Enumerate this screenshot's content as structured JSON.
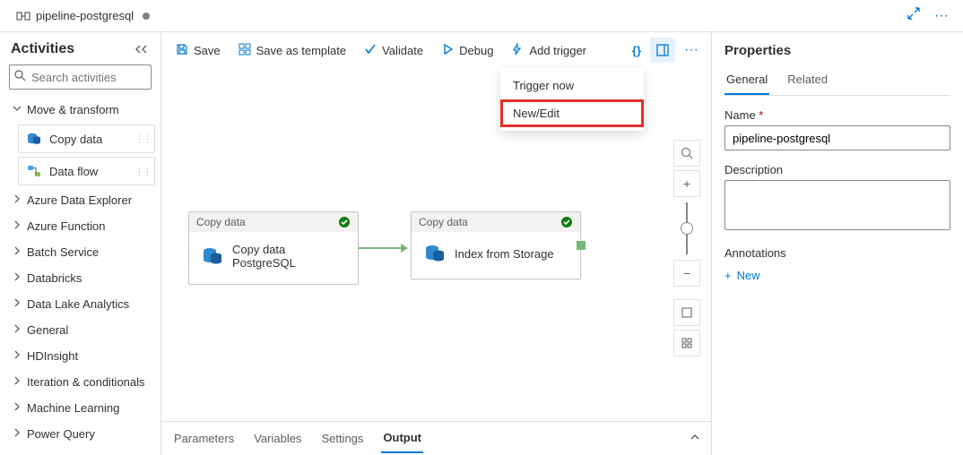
{
  "topTab": {
    "title": "pipeline-postgresql",
    "unsaved": true
  },
  "topRight": {
    "more": "···"
  },
  "activities": {
    "title": "Activities",
    "searchPlaceholder": "Search activities",
    "moveTransform": {
      "label": "Move & transform",
      "expanded": true
    },
    "tiles": {
      "copyData": "Copy data",
      "dataFlow": "Data flow"
    },
    "categories": [
      "Azure Data Explorer",
      "Azure Function",
      "Batch Service",
      "Databricks",
      "Data Lake Analytics",
      "General",
      "HDInsight",
      "Iteration & conditionals",
      "Machine Learning",
      "Power Query"
    ]
  },
  "toolbar": {
    "save": "Save",
    "saveTemplate": "Save as template",
    "validate": "Validate",
    "debug": "Debug",
    "addTrigger": "Add trigger",
    "code": "{}",
    "more": "···"
  },
  "triggerMenu": {
    "now": "Trigger now",
    "newEdit": "New/Edit"
  },
  "nodes": {
    "a": {
      "type": "Copy data",
      "title": "Copy data PostgreSQL"
    },
    "b": {
      "type": "Copy data",
      "title": "Index from Storage"
    }
  },
  "bottomTabs": {
    "parameters": "Parameters",
    "variables": "Variables",
    "settings": "Settings",
    "output": "Output"
  },
  "properties": {
    "header": "Properties",
    "tabs": {
      "general": "General",
      "related": "Related"
    },
    "nameLabel": "Name",
    "nameValue": "pipeline-postgresql",
    "descLabel": "Description",
    "descValue": "",
    "annotationsLabel": "Annotations",
    "new": "New"
  }
}
